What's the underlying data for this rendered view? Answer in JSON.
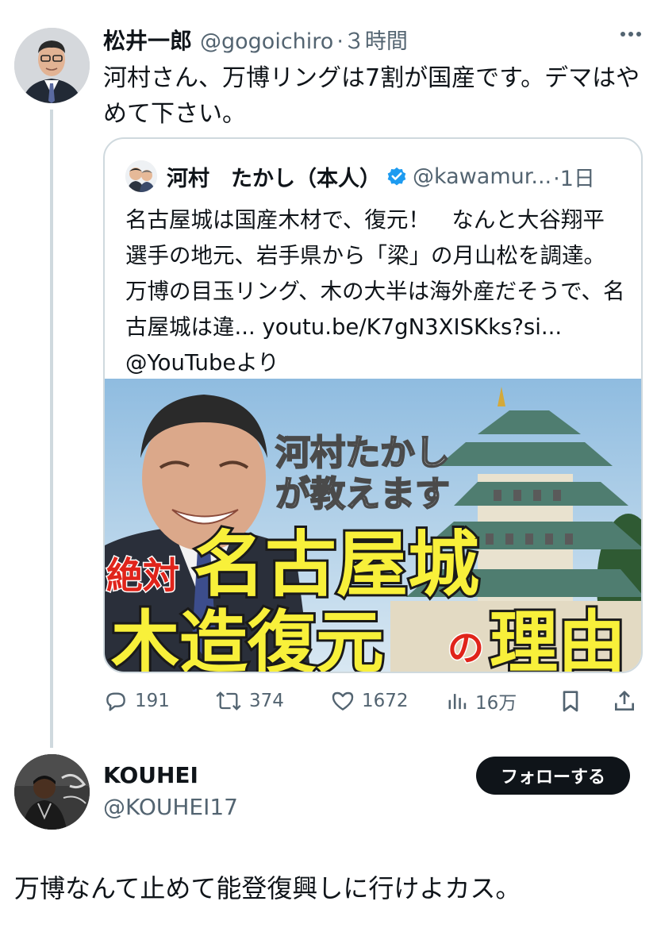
{
  "tweet": {
    "author_name": "松井一郎",
    "author_handle": "@gogoichiro",
    "time": "·３時間",
    "text": "河村さん、万博リングは7割が国産です。デマはやめて下さい。"
  },
  "quote": {
    "author_name": "河村　たかし（本人）",
    "author_handle": "@kawamur...",
    "time": "·1日",
    "text": "名古屋城は国産木材で、復元！　なんと大谷翔平選手の地元、岩手県から「梁」の月山松を調達。万博の目玉リング、木の大半は海外産だそうで、名古屋城は違... youtu.be/K7gN3XISKks?si... @YouTubeより",
    "thumbnail": {
      "caption_line1": "河村たかし",
      "caption_line2": "が教えます",
      "prefix": "絶対",
      "title_line1": "名古屋城",
      "title_line2a": "木造復元",
      "title_particle": "の",
      "title_line2b": "理由"
    }
  },
  "actions": {
    "replies": "191",
    "retweets": "374",
    "likes": "1672",
    "views": "16万"
  },
  "reply": {
    "author_name": "KOUHEI",
    "author_handle": "@KOUHEI17",
    "follow_label": "フォローする",
    "text": "万博なんて止めて能登復興しに行けよカス。"
  },
  "colors": {
    "text": "#0f1419",
    "secondary": "#536471",
    "border": "#cfd9de",
    "verified": "#1d9bf0",
    "thumb_title_yellow": "#f8f03a",
    "thumb_red": "#e0241b"
  },
  "icons": [
    "reply-icon",
    "retweet-icon",
    "like-icon",
    "views-icon",
    "bookmark-icon",
    "share-icon",
    "verified-badge-icon",
    "more-icon"
  ]
}
